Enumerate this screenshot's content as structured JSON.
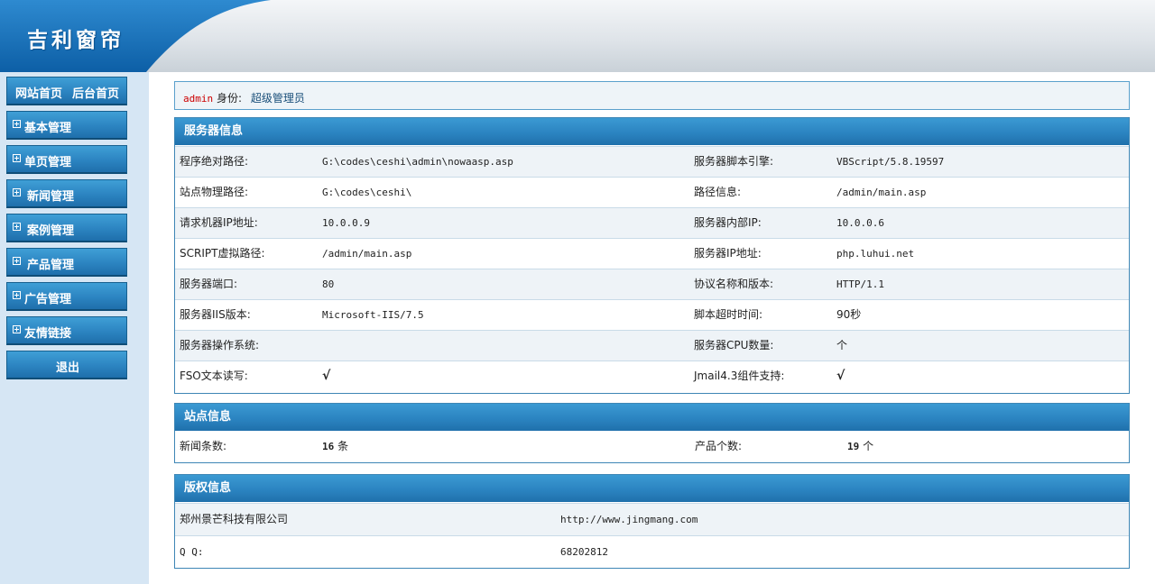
{
  "header": {
    "logo": "吉利窗帘"
  },
  "sidebar": {
    "top_links": {
      "site_home": "网站首页",
      "admin_home": "后台首页"
    },
    "items": [
      {
        "label": "基本管理"
      },
      {
        "label": "单页管理"
      },
      {
        "label": "新闻管理"
      },
      {
        "label": "案例管理"
      },
      {
        "label": "产品管理"
      },
      {
        "label": "广告管理"
      },
      {
        "label": "友情链接"
      }
    ],
    "logout": "退出"
  },
  "user_bar": {
    "username": "admin",
    "role_label": "身份:",
    "role": "超级管理员"
  },
  "server_info": {
    "title": "服务器信息",
    "rows": [
      {
        "l1": "程序绝对路径:",
        "v1": "G:\\codes\\ceshi\\admin\\nowaasp.asp",
        "l2": "服务器脚本引擎:",
        "v2": "VBScript/5.8.19597"
      },
      {
        "l1": "站点物理路径:",
        "v1": "G:\\codes\\ceshi\\",
        "l2": "路径信息:",
        "v2": "/admin/main.asp"
      },
      {
        "l1": "请求机器IP地址:",
        "v1": "10.0.0.9",
        "l2": "服务器内部IP:",
        "v2": "10.0.0.6"
      },
      {
        "l1": "SCRIPT虚拟路径:",
        "v1": "/admin/main.asp",
        "l2": "服务器IP地址:",
        "v2": "php.luhui.net"
      },
      {
        "l1": "服务器端口:",
        "v1": "80",
        "l2": "协议名称和版本:",
        "v2": "HTTP/1.1"
      },
      {
        "l1": "服务器IIS版本:",
        "v1": "Microsoft-IIS/7.5",
        "l2": "脚本超时时间:",
        "v2": "90秒"
      },
      {
        "l1": "服务器操作系统:",
        "v1": "",
        "l2": "服务器CPU数量:",
        "v2": "个"
      },
      {
        "l1": "FSO文本读写:",
        "v1": "√",
        "l2": "Jmail4.3组件支持:",
        "v2": "√"
      }
    ]
  },
  "site_info": {
    "title": "站点信息",
    "news_label": "新闻条数:",
    "news_count": "16",
    "news_unit": "条",
    "product_label": "产品个数:",
    "product_count": "19",
    "product_unit": "个"
  },
  "copyright": {
    "title": "版权信息",
    "company": "郑州景芒科技有限公司",
    "url": "http://www.jingmang.com",
    "qq_label": "Q Q:",
    "qq": "68202812"
  },
  "colors": {
    "accent": "#2a82bf",
    "sidebar_bg": "#d6e6f4",
    "username": "#cc0000"
  }
}
